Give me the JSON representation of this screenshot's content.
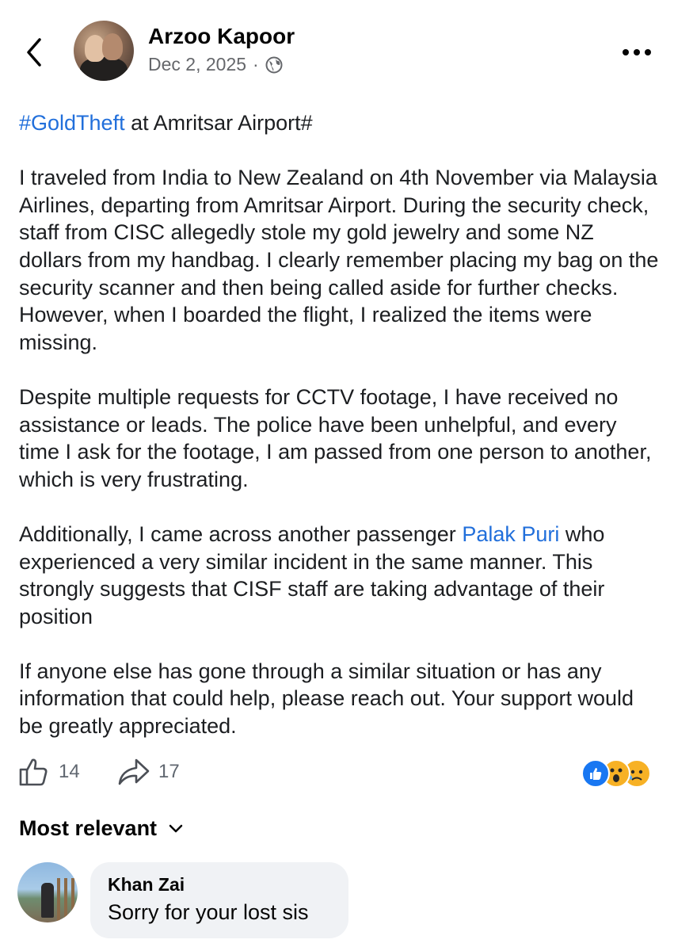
{
  "header": {
    "back_icon": "chevron-left-icon",
    "author_name": "Arzoo Kapoor",
    "date": "Dec 2, 2025",
    "separator": "·",
    "privacy_icon": "globe-icon",
    "more_icon": "more-horizontal-icon"
  },
  "post": {
    "hashtag": "#GoldTheft",
    "title_rest": " at Amritsar Airport#",
    "para1": "I traveled from India to New Zealand on 4th November via Malaysia Airlines, departing from Amritsar Airport. During the security check, staff from CISC allegedly stole my gold jewelry and some NZ dollars from my handbag. I clearly remember placing my bag on the security scanner and then being called aside for further checks. However, when I boarded the flight, I realized the items were missing.",
    "para2": "Despite multiple requests for CCTV footage, I have received no assistance or leads. The police have been unhelpful, and every time I ask for the footage, I am passed from one person to another, which is very frustrating.",
    "para3_before": "Additionally, I came across another passenger ",
    "para3_mention": "Palak Puri",
    "para3_after": " who experienced a very similar incident in the same manner. This strongly suggests that CISF staff are taking advantage of their position",
    "para4": "If anyone else has gone through a similar situation or has any information that could help, please reach out. Your support would be greatly appreciated."
  },
  "actions": {
    "like_icon": "thumbs-up-icon",
    "like_count": "14",
    "share_icon": "share-arrow-icon",
    "share_count": "17",
    "reactions": [
      "like-reaction-icon",
      "wow-reaction-icon",
      "sad-reaction-icon"
    ]
  },
  "comments": {
    "sort_label": "Most relevant",
    "sort_icon": "chevron-down-icon",
    "items": [
      {
        "author": "Khan Zai",
        "text": "Sorry for your lost sis"
      }
    ]
  },
  "colors": {
    "link": "#216fdb",
    "meta_text": "#65676b",
    "bubble_bg": "#f0f2f5",
    "like_blue": "#1877f2",
    "emoji_yellow": "#f7b125"
  }
}
